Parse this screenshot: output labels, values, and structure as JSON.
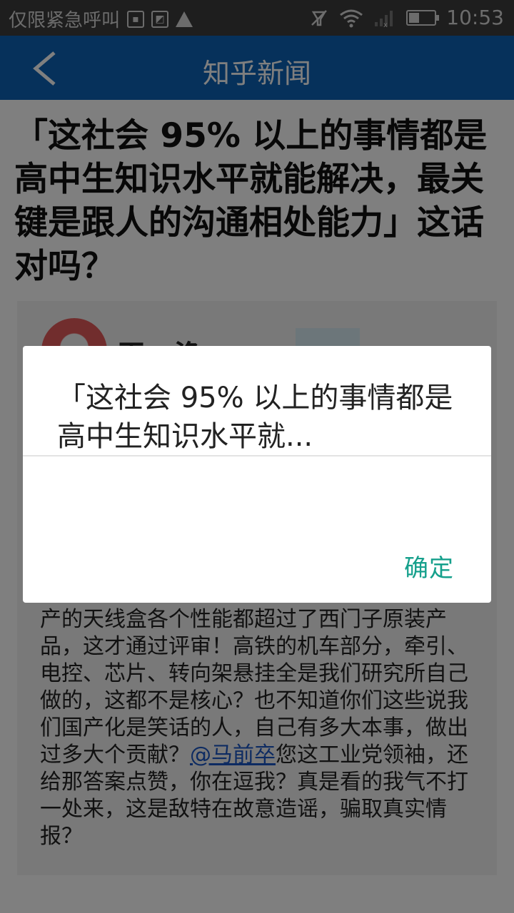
{
  "status_bar": {
    "carrier": "仅限紧急呼叫",
    "time": "10:53",
    "icons": [
      "sim-icon",
      "image-icon",
      "warning-icon",
      "silent-icon",
      "wifi-icon",
      "signal-icon",
      "battery-icon"
    ]
  },
  "app_bar": {
    "title": "知乎新闻",
    "back_icon": "chevron-left-icon"
  },
  "question": {
    "title": "「这社会 95% 以上的事情都是高中生知识水平就能解决，最关键是跟人的沟通相处能力」这话对吗？"
  },
  "answer": {
    "author_partial": "王…渔",
    "body_before_mention": "产的天线盒各个性能都超过了西门子原装产品，这才通过评审！高铁的机车部分，牵引、电控、芯片、转向架悬挂全是我们研究所自己做的，这都不是核心？也不知道你们这些说我们国产化是笑话的人，自己有多大本事，做出过多大个贡献？",
    "mention": "@马前卒",
    "body_after_mention": "您这工业党领袖，还给那答案点赞，你在逗我？真是看的我气不打一处来，这是敌特在故意造谣，骗取真实情报？"
  },
  "dialog": {
    "title": "「这社会 95% 以上的事情都是高中生知识水平就...",
    "ok_label": "确定"
  },
  "colors": {
    "app_bar": "#0d63b6",
    "status_bar": "#3c3c3c",
    "dialog_button": "#16a08c",
    "link": "#1a56c4"
  }
}
